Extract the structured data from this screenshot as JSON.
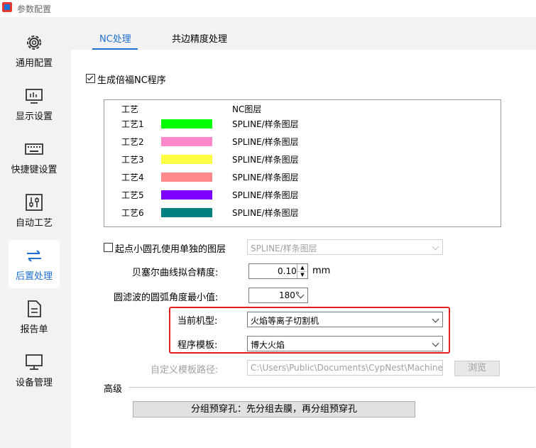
{
  "window": {
    "title": "参数配置"
  },
  "sidebar": {
    "items": [
      {
        "label": "通用配置",
        "icon": "gear-icon"
      },
      {
        "label": "显示设置",
        "icon": "monitor-chart-icon"
      },
      {
        "label": "快捷键设置",
        "icon": "keyboard-icon"
      },
      {
        "label": "自动工艺",
        "icon": "sliders-icon"
      },
      {
        "label": "后置处理",
        "icon": "swap-arrows-icon",
        "active": true
      },
      {
        "label": "报告单",
        "icon": "document-icon"
      },
      {
        "label": "设备管理",
        "icon": "desktop-icon"
      }
    ]
  },
  "tabs": [
    {
      "label": "NC处理",
      "active": true
    },
    {
      "label": "共边精度处理",
      "active": false
    }
  ],
  "generate_nc": {
    "label": "生成倍福NC程序",
    "checked": true
  },
  "process_table": {
    "headers": {
      "name": "工艺",
      "layer": "NC图层"
    },
    "rows": [
      {
        "name": "工艺1",
        "color": "#00ff00",
        "layer": "SPLINE/样条图层"
      },
      {
        "name": "工艺2",
        "color": "#ff88c8",
        "layer": "SPLINE/样条图层"
      },
      {
        "name": "工艺3",
        "color": "#ffff44",
        "layer": "SPLINE/样条图层"
      },
      {
        "name": "工艺4",
        "color": "#ff8888",
        "layer": "SPLINE/样条图层"
      },
      {
        "name": "工艺5",
        "color": "#8000ff",
        "layer": "SPLINE/样条图层"
      },
      {
        "name": "工艺6",
        "color": "#008080",
        "layer": "SPLINE/样条图层"
      }
    ]
  },
  "small_hole": {
    "label": "起点小圆孔使用单独的图层",
    "checked": false,
    "value": "SPLINE/样条图层"
  },
  "bezier": {
    "label": "贝塞尔曲线拟合精度:",
    "value": "0.10",
    "unit": "mm"
  },
  "arc_filter": {
    "label": "圆滤波的圆弧角度最小值:",
    "value": "180°"
  },
  "machine": {
    "label": "当前机型:",
    "value": "火焰等离子切割机"
  },
  "template": {
    "label": "程序模板:",
    "value": "博大火焰"
  },
  "custom_path": {
    "label": "自定义模板路径:",
    "value": "C:\\Users\\Public\\Documents\\CypNest\\Machine",
    "browse": "浏览"
  },
  "advanced": {
    "label": "高级",
    "button": "分组预穿孔：先分组去膜，再分组预穿孔"
  }
}
